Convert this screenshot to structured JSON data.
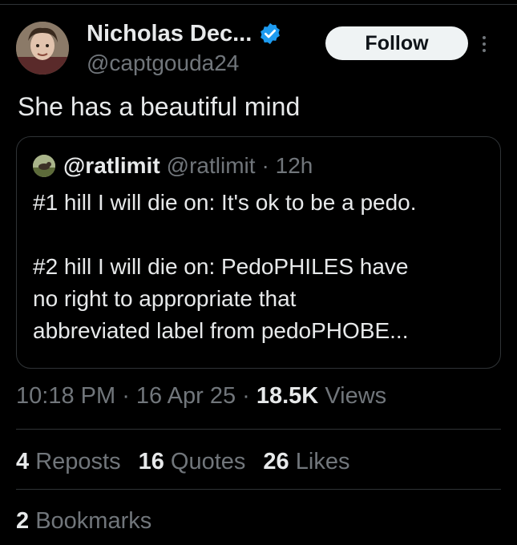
{
  "author": {
    "name": "Nicholas Dec...",
    "handle": "@captgouda24",
    "verified_color": "#1d9bf0"
  },
  "follow_label": "Follow",
  "tweet_text": "She has a beautiful mind",
  "quoted": {
    "name": "@ratlimit",
    "handle": "@ratlimit",
    "time": "· 12h",
    "lines": [
      "#1 hill I will die on: It's ok to be a pedo.",
      "#2 hill I will die on: PedoPHILES have",
      "no right to appropriate that",
      "abbreviated label from pedoPHOBE..."
    ]
  },
  "meta": {
    "time": "10:18 PM",
    "date": "16 Apr 25",
    "views_count": "18.5K",
    "views_label": "Views"
  },
  "stats": {
    "reposts_count": "4",
    "reposts_label": "Reposts",
    "quotes_count": "16",
    "quotes_label": "Quotes",
    "likes_count": "26",
    "likes_label": "Likes",
    "bookmarks_count": "2",
    "bookmarks_label": "Bookmarks"
  },
  "colors": {
    "background": "#000000",
    "text": "#e7e9ea",
    "secondary": "#71767b",
    "border": "#2f3336",
    "verified": "#1d9bf0"
  }
}
